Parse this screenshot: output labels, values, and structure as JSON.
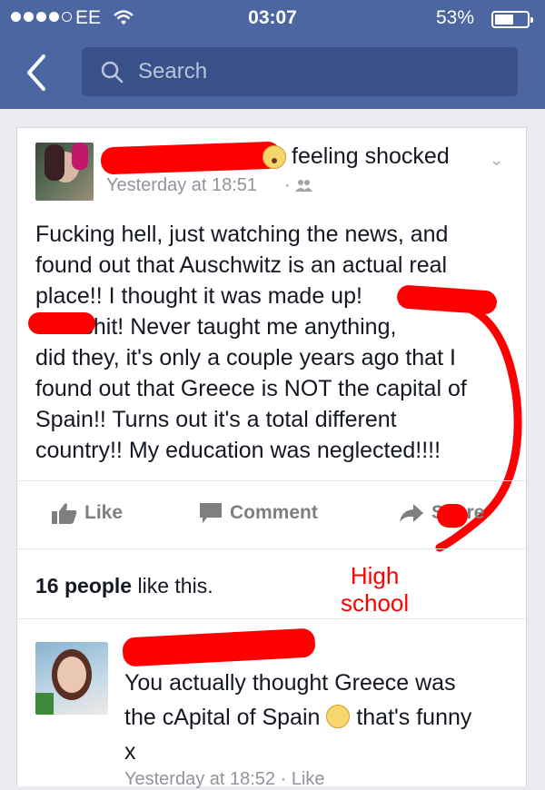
{
  "status_bar": {
    "carrier": "EE",
    "time": "03:07",
    "battery": "53%",
    "battery_level": 0.53
  },
  "nav": {
    "search_placeholder": "Search"
  },
  "post": {
    "feeling": "feeling shocked",
    "timestamp": "Yesterday at 18:51",
    "separator": "·",
    "text": "Fucking hell, just watching the news, and\nfound out that Auschwitz is an actual real\nplace!!  I thought it was made up!\n        was shit!  Never taught me anything,\ndid they, it's only a couple years ago that I\nfound out that Greece is NOT the capital of\nSpain!!  Turns out it's a total different\ncountry!! My education was neglected!!!!",
    "actions": {
      "like": "Like",
      "comment": "Comment",
      "share": "Share"
    },
    "likes_count": "16 people",
    "likes_suffix": " like this."
  },
  "annotation": {
    "line1": "High",
    "line2": "school"
  },
  "comment": {
    "text_before": "You actually thought Greece was\nthe cApital of Spain ",
    "text_after": "  that's funny\nx",
    "meta": "Yesterday at 18:52 · Like"
  }
}
